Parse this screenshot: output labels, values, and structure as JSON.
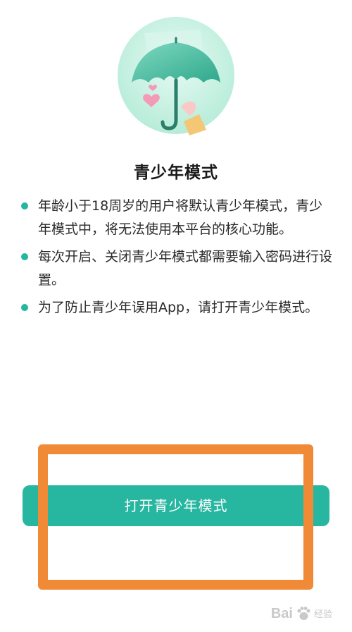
{
  "header": {
    "title": "青少年模式"
  },
  "bullets": [
    "年龄小于18周岁的用户将默认青少年模式，青少年模式中，将无法使用本平台的核心功能。",
    "每次开启、关闭青少年模式都需要输入密码进行设置。",
    "为了防止青少年误用App，请打开青少年模式。"
  ],
  "actions": {
    "primary_label": "打开青少年模式"
  },
  "watermark": {
    "text": "Bai",
    "sub": "经验"
  },
  "colors": {
    "accent": "#27b6a0",
    "highlight": "#f08a36"
  },
  "icons": {
    "hero": "umbrella-illustration",
    "bullet": "dot-icon"
  }
}
